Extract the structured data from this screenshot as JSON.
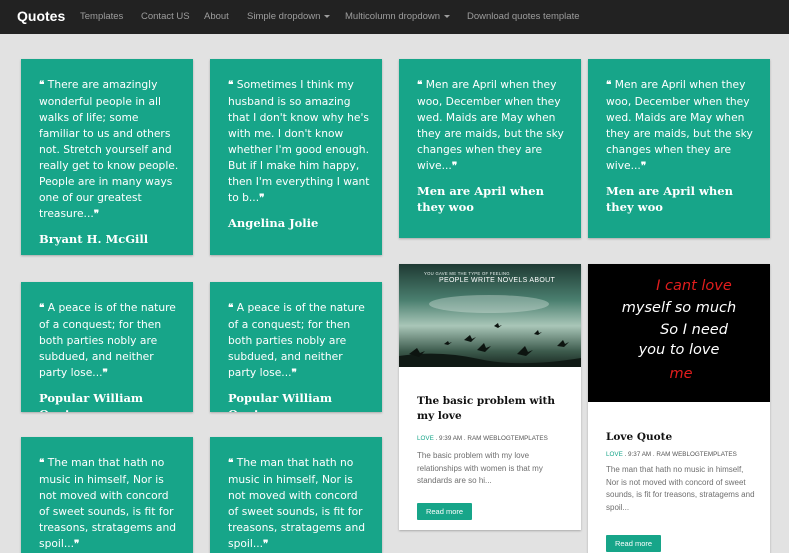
{
  "nav": {
    "brand": "Quotes",
    "items": [
      {
        "label": "Templates"
      },
      {
        "label": "Contact US"
      },
      {
        "label": "About"
      },
      {
        "label": "Simple dropdown"
      },
      {
        "label": "Multicolumn dropdown"
      },
      {
        "label": "Download quotes template"
      }
    ]
  },
  "quotes": [
    {
      "text": "There are amazingly wonderful people in all walks of life; some familiar to us and others not. Stretch yourself and really get to know people. People are in many ways one of our greatest treasure...",
      "author": "Bryant H. McGill"
    },
    {
      "text": "Sometimes I think my husband is so amazing that I don't know why he's with me. I don't know whether I'm good enough. But if I make him happy, then I'm everything I want to b...",
      "author": "Angelina Jolie"
    },
    {
      "text": "Men are April when they woo, December when they wed. Maids are May when they are maids, but the sky changes when they are wive...",
      "author": "Men are April when they woo"
    },
    {
      "text": "Men are April when they woo, December when they wed. Maids are May when they are maids, but the sky changes when they are wive...",
      "author": "Men are April when they woo"
    },
    {
      "text": "A peace is of the nature of a conquest; for then both parties nobly are subdued, and neither party lose...",
      "author": "Popular William Quote"
    },
    {
      "text": "A peace is of the nature of a conquest; for then both parties nobly are subdued, and neither party lose...",
      "author": "Popular William Quote"
    },
    {
      "text": "The man that hath no music in himself, Nor is not moved with concord of sweet sounds, is fit for treasons, stratagems and spoil...",
      "author": ""
    },
    {
      "text": "The man that hath no music in himself, Nor is not moved with concord of sweet sounds, is fit for treasons, stratagems and spoil...",
      "author": ""
    }
  ],
  "posts": [
    {
      "image_small_text": "YOU GAVE ME THE TYPE OF FEELING",
      "image_big_text": "PEOPLE WRITE NOVELS ABOUT",
      "title": "The basic problem with my love",
      "tag": "LOVE",
      "meta": " . 9:39 AM . RAM WEBLOGTEMPLATES",
      "excerpt": "The basic problem with my love relationships with women is that my standards are so hi...",
      "button": "Read more"
    },
    {
      "image_lines": [
        "I cant love",
        "myself so much",
        "So I need",
        "you to love",
        "me"
      ],
      "title": "Love Quote",
      "tag": "LOVE",
      "meta": " . 9:37 AM . RAM WEBLOGTEMPLATES",
      "excerpt": "The man that hath no music in himself, Nor is not moved with concord of sweet sounds, is fit for treasons, stratagems and spoil...",
      "button": "Read more"
    }
  ],
  "colors": {
    "accent": "#17a589",
    "navbar": "#222222",
    "background": "#e2e2e2"
  }
}
